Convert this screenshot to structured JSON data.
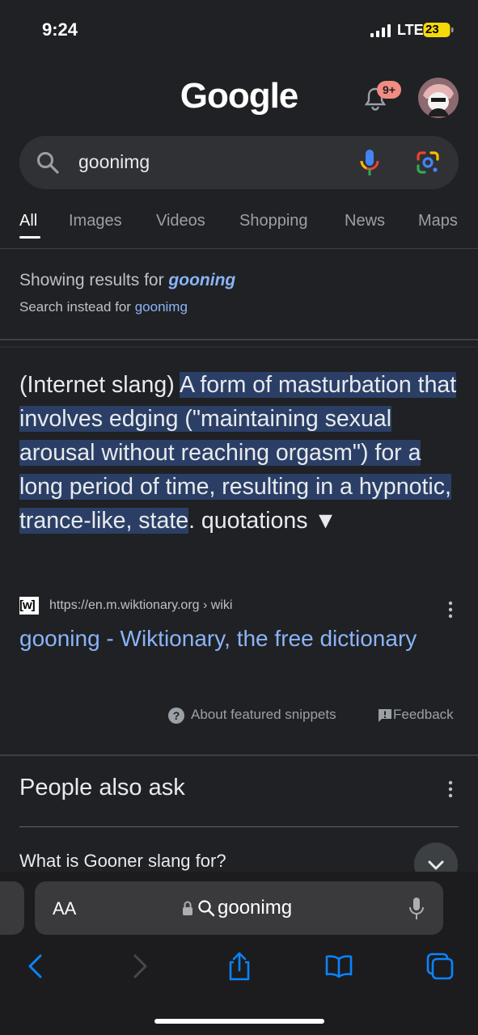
{
  "status": {
    "time": "9:24",
    "network": "LTE",
    "battery": "23"
  },
  "header": {
    "logo": "Google",
    "notification_count": "9+"
  },
  "search": {
    "query": "goonimg"
  },
  "tabs": [
    {
      "label": "All",
      "active": true
    },
    {
      "label": "Images"
    },
    {
      "label": "Videos"
    },
    {
      "label": "Shopping"
    },
    {
      "label": "News"
    },
    {
      "label": "Maps"
    }
  ],
  "spelling": {
    "showing_prefix": "Showing results for ",
    "corrected": "gooning",
    "instead_prefix": "Search instead for ",
    "original": "goonimg"
  },
  "snippet": {
    "lead": "(Internet slang) ",
    "highlight": "A form of masturbation that involves edging (\"maintaining sexual arousal without reaching orgasm\") for a long period of time, resulting in a hypnotic, trance-like, state",
    "tail": ". quotations ▼",
    "source_icon": "[w]",
    "citation": "https://en.m.wiktionary.org › wiki",
    "result_title": "gooning - Wiktionary, the free dictionary",
    "about": "About featured snippets",
    "feedback": "Feedback"
  },
  "paa": {
    "title": "People also ask",
    "questions": [
      "What is Gooner slang for?"
    ]
  },
  "safari": {
    "text_size": "AA",
    "url": "goonimg"
  },
  "colors": {
    "link": "#8ab4f8",
    "highlight": "#2b3f66",
    "accent_safari": "#0a84ff"
  }
}
